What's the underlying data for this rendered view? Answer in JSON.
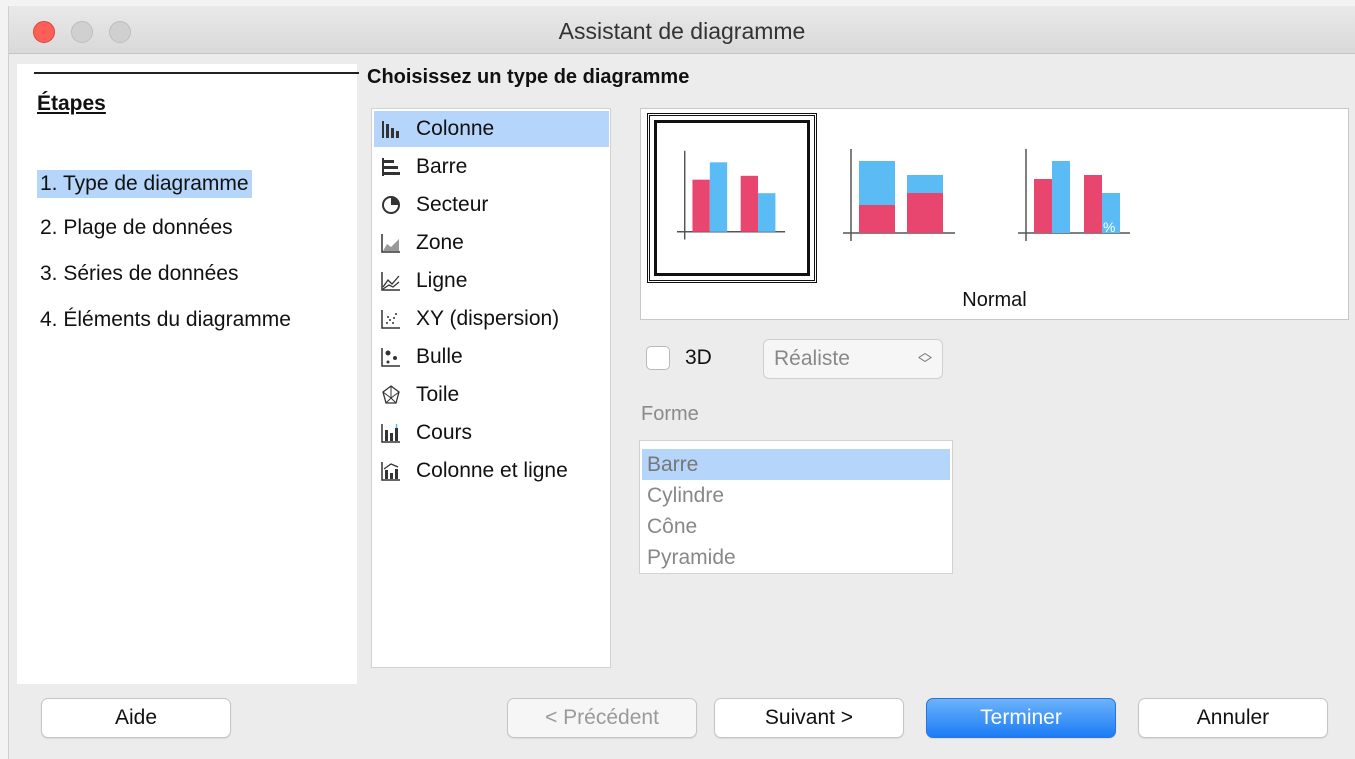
{
  "window": {
    "title": "Assistant de diagramme"
  },
  "steps": {
    "title": "Étapes",
    "items": [
      "1. Type de diagramme",
      "2. Plage de données",
      "3. Séries de données",
      "4. Éléments du diagramme"
    ],
    "selected_index": 0
  },
  "main": {
    "heading": "Choisissez un type de diagramme",
    "chart_types": [
      {
        "label": "Colonne",
        "icon": "column-chart-icon"
      },
      {
        "label": "Barre",
        "icon": "bar-chart-icon"
      },
      {
        "label": "Secteur",
        "icon": "pie-chart-icon"
      },
      {
        "label": "Zone",
        "icon": "area-chart-icon"
      },
      {
        "label": "Ligne",
        "icon": "line-chart-icon"
      },
      {
        "label": "XY (dispersion)",
        "icon": "scatter-chart-icon"
      },
      {
        "label": "Bulle",
        "icon": "bubble-chart-icon"
      },
      {
        "label": "Toile",
        "icon": "net-chart-icon"
      },
      {
        "label": "Cours",
        "icon": "stock-chart-icon"
      },
      {
        "label": "Colonne et ligne",
        "icon": "column-line-chart-icon"
      }
    ],
    "selected_type_index": 0,
    "variant_name": "Normal",
    "variants": [
      "normal",
      "stacked",
      "percent-stacked"
    ],
    "selected_variant_index": 0,
    "checkbox_3d_label": "3D",
    "checkbox_3d_checked": false,
    "style_3d_value": "Réaliste",
    "forme_label": "Forme",
    "forme_items": [
      "Barre",
      "Cylindre",
      "Cône",
      "Pyramide"
    ],
    "forme_selected_index": 0,
    "percent_symbol": "%"
  },
  "buttons": {
    "help": "Aide",
    "previous": "< Précédent",
    "next": "Suivant >",
    "finish": "Terminer",
    "cancel": "Annuler"
  },
  "colors": {
    "pink": "#e8456f",
    "blue": "#5bbcf5",
    "selection": "#b5d5fb",
    "primary_button": "#1b7cf5",
    "close_button": "#fc5f57"
  }
}
